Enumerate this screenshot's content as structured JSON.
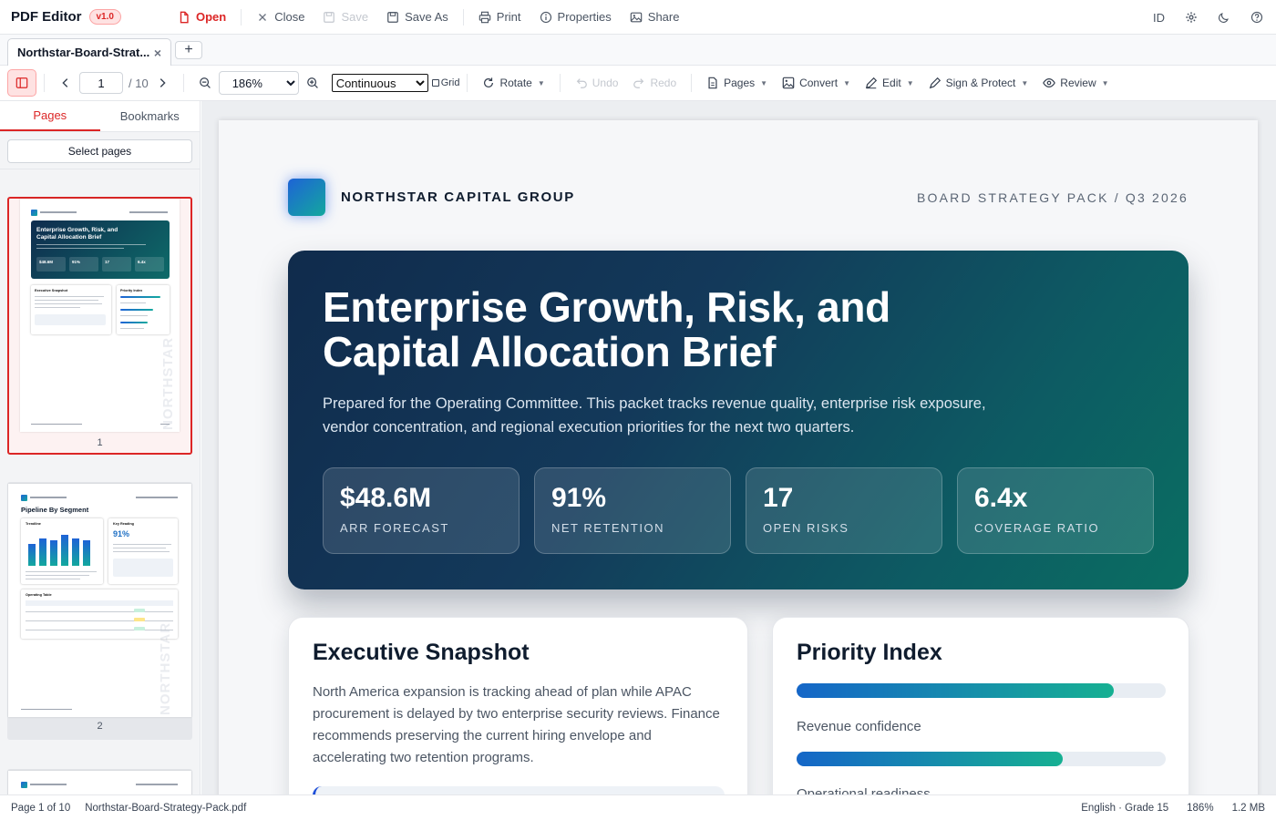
{
  "app": {
    "title": "PDF Editor",
    "version": "v1.0"
  },
  "menu": {
    "open": "Open",
    "close": "Close",
    "save": "Save",
    "save_as": "Save As",
    "print": "Print",
    "properties": "Properties",
    "share": "Share",
    "lang_code": "ID"
  },
  "tabs": {
    "active": "Northstar-Board-Strat...",
    "close_glyph": "×",
    "new_glyph": "+"
  },
  "toolbar": {
    "page_current": "1",
    "page_total": "/ 10",
    "zoom": "186%",
    "zoom_options": [
      "186%"
    ],
    "view_mode": "Continuous",
    "grid_label": "Grid",
    "rotate": "Rotate",
    "undo": "Undo",
    "redo": "Redo",
    "pages": "Pages",
    "convert": "Convert",
    "edit": "Edit",
    "sign_protect": "Sign & Protect",
    "review": "Review"
  },
  "sidebar": {
    "tab_pages": "Pages",
    "tab_bookmarks": "Bookmarks",
    "select_pages": "Select pages",
    "thumb1": {
      "num": "1",
      "title_l1": "Enterprise Growth, Risk, and",
      "title_l2": "Capital Allocation Brief",
      "kpis": [
        "$48.6M",
        "91%",
        "17",
        "6.4x"
      ],
      "card_left": "Executive Snapshot",
      "card_right": "Priority Index",
      "watermark": "NORTHSTAR"
    },
    "thumb2": {
      "num": "2",
      "heading": "Pipeline By Segment",
      "trendline": "Trendline",
      "key_reading": "Key Reading",
      "key_value": "91%",
      "operating_table": "Operating Table",
      "watermark": "NORTHSTAR"
    }
  },
  "document": {
    "company": "NORTHSTAR CAPITAL GROUP",
    "pack": "BOARD STRATEGY PACK / Q3 2026",
    "title_l1": "Enterprise Growth, Risk, and",
    "title_l2": "Capital Allocation Brief",
    "subtitle": "Prepared for the Operating Committee. This packet tracks revenue quality, enterprise risk exposure, vendor concentration, and regional execution priorities for the next two quarters.",
    "kpis": [
      {
        "value": "$48.6M",
        "label": "ARR FORECAST"
      },
      {
        "value": "91%",
        "label": "NET RETENTION"
      },
      {
        "value": "17",
        "label": "OPEN RISKS"
      },
      {
        "value": "6.4x",
        "label": "COVERAGE RATIO"
      }
    ],
    "snapshot": {
      "title": "Executive Snapshot",
      "body": "North America expansion is tracking ahead of plan while APAC procurement is delayed by two enterprise security reviews. Finance recommends preserving the current hiring envelope and accelerating two retention programs."
    },
    "priority": {
      "title": "Priority Index",
      "items": [
        {
          "label": "Revenue confidence",
          "fraction": 0.86
        },
        {
          "label": "Operational readiness",
          "fraction": 0.72
        }
      ]
    }
  },
  "status": {
    "page": "Page 1 of 10",
    "file": "Northstar-Board-Strategy-Pack.pdf",
    "language": "English · Grade 15",
    "zoom": "186%",
    "size": "1.2 MB"
  },
  "colors": {
    "accent": "#dc2626",
    "hero_start": "#102b4c",
    "hero_end": "#0a6e62",
    "bar_start": "#1566c8",
    "bar_end": "#16b092"
  }
}
